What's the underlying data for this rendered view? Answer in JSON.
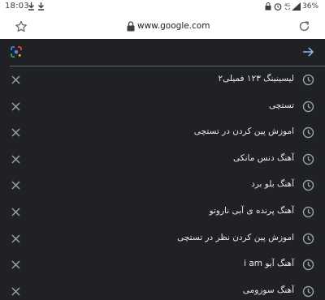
{
  "status_bar": {
    "time": "18:03",
    "battery": "36%",
    "network": "4G"
  },
  "address_bar": {
    "url": "www.google.com"
  },
  "search": {
    "value": ""
  },
  "suggestions": [
    "لیسینینگ ۱۲۳ فمیلی۲",
    "تستچی",
    "اموزش پین کردن در تستچی",
    "آهنگ دنس مانکی",
    "آهنگ بلو برد",
    "آهنگ پرنده ی آبی ناروتو",
    "اموزش پین کردن نظر در تستچی",
    "آهنگ آیو i am",
    "آهنگ سوزومی"
  ],
  "colors": {
    "background": "#202124",
    "text": "#e8eaed",
    "icon_gray": "#9aa0a6",
    "accent_blue": "#8ab4f8"
  }
}
